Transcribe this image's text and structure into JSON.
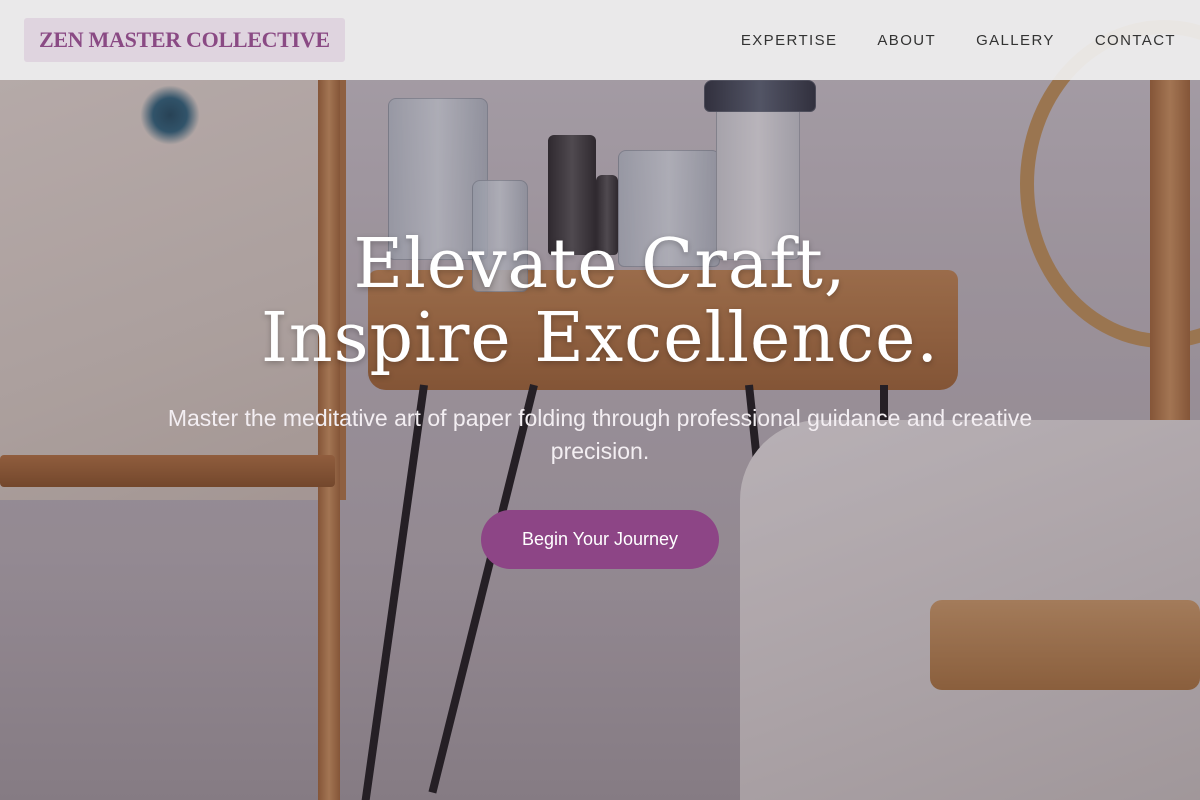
{
  "header": {
    "logo": "ZEN MASTER COLLECTIVE",
    "nav": [
      {
        "label": "EXPERTISE"
      },
      {
        "label": "ABOUT"
      },
      {
        "label": "GALLERY"
      },
      {
        "label": "CONTACT"
      }
    ]
  },
  "hero": {
    "title": "Elevate Craft, Inspire Excellence.",
    "subtitle": "Master the meditative art of paper folding through professional guidance and creative precision.",
    "cta_label": "Begin Your Journey"
  },
  "colors": {
    "brand": "#8d4586",
    "logo_text": "#8a4a84",
    "header_bg": "#f0f0f0",
    "nav_text": "#333333"
  }
}
